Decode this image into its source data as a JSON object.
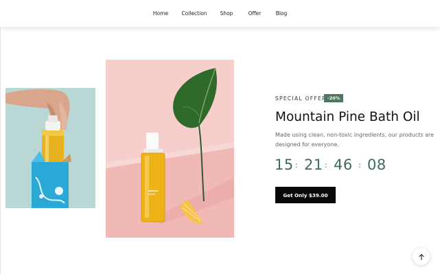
{
  "nav": {
    "items": [
      {
        "label": "Home"
      },
      {
        "label": "Collection"
      },
      {
        "label": "Shop"
      },
      {
        "label": "Offer"
      },
      {
        "label": "Blog"
      }
    ]
  },
  "offer": {
    "eyebrow": "SPECIAL OFFER",
    "badge": "-20%",
    "title": "Mountain Pine Bath Oil",
    "description": "Made using clean, non-toxic ingredients, our products are designed for everyone.",
    "countdown": {
      "hours": "15",
      "minutes": "21",
      "seconds": "46",
      "frames": "08",
      "separator": ":"
    },
    "button_label": "Get Only $39.00"
  },
  "icons": {
    "back_to_top": "arrow-up-icon"
  },
  "colors": {
    "accent": "#4e7660",
    "countdown": "#416b54",
    "button": "#080808"
  }
}
